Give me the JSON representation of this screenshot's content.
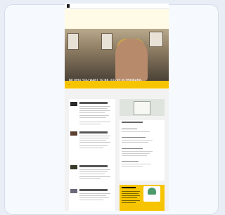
{
  "colors": {
    "accent": "#f6c400",
    "background": "#e9eef6",
    "page": "#ffffff"
  },
  "header": {
    "logo_icon": "university-logo-icon"
  },
  "hero": {
    "caption": "BE WHO YOU WANT TO BE. STUDY IN FREIBURG."
  },
  "banner": {
    "arrow": "→"
  }
}
